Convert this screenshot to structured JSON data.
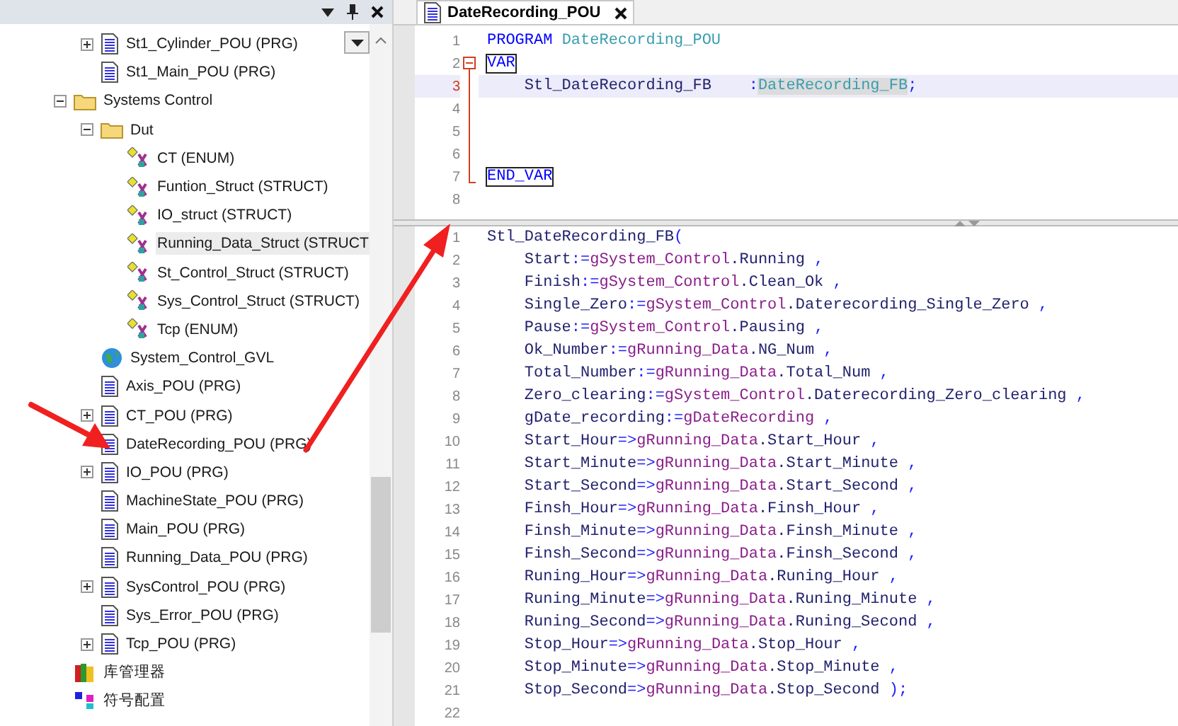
{
  "tree": [
    {
      "children": [
        {
          "label": "St1_Cylinder_POU (PRG)",
          "kind": "pou",
          "expanded": false,
          "selected": false
        },
        {
          "label": "St1_Main_POU (PRG)",
          "kind": "pou",
          "selected": false
        }
      ]
    },
    {
      "label": "Systems Control",
      "kind": "folder",
      "expanded": true,
      "selected": false,
      "children": [
        {
          "label": "Dut",
          "kind": "folder",
          "expanded": true,
          "selected": false,
          "children": [
            {
              "label": "CT (ENUM)",
              "kind": "dut",
              "selected": false
            },
            {
              "label": "Funtion_Struct (STRUCT)",
              "kind": "dut",
              "selected": false
            },
            {
              "label": "IO_struct (STRUCT)",
              "kind": "dut",
              "selected": false
            },
            {
              "label": "Running_Data_Struct (STRUCT",
              "kind": "dut",
              "selected": true
            },
            {
              "label": "St_Control_Struct (STRUCT)",
              "kind": "dut",
              "selected": false
            },
            {
              "label": "Sys_Control_Struct (STRUCT)",
              "kind": "dut",
              "selected": false
            },
            {
              "label": "Tcp (ENUM)",
              "kind": "dut",
              "selected": false
            }
          ]
        },
        {
          "label": "System_Control_GVL",
          "kind": "gvl",
          "selected": false
        },
        {
          "label": "Axis_POU (PRG)",
          "kind": "pou",
          "selected": false
        },
        {
          "label": "CT_POU (PRG)",
          "kind": "pou",
          "expanded": false,
          "selected": false
        },
        {
          "label": "DateRecording_POU (PRG)",
          "kind": "pou",
          "selected": false
        },
        {
          "label": "IO_POU (PRG)",
          "kind": "pou",
          "expanded": false,
          "selected": false
        },
        {
          "label": "MachineState_POU (PRG)",
          "kind": "pou",
          "selected": false
        },
        {
          "label": "Main_POU (PRG)",
          "kind": "pou",
          "selected": false
        },
        {
          "label": "Running_Data_POU (PRG)",
          "kind": "pou",
          "selected": false
        },
        {
          "label": "SysControl_POU (PRG)",
          "kind": "pou",
          "expanded": false,
          "selected": false
        },
        {
          "label": "Sys_Error_POU (PRG)",
          "kind": "pou",
          "selected": false
        },
        {
          "label": "Tcp_POU (PRG)",
          "kind": "pou",
          "expanded": false,
          "selected": false
        }
      ]
    },
    {
      "label": "库管理器",
      "kind": "library",
      "selected": false
    },
    {
      "label": "符号配置",
      "kind": "symbol",
      "selected": false
    }
  ],
  "editor": {
    "tab": {
      "label": "DateRecording_POU",
      "selected": true
    },
    "declaration": [
      {
        "number": "1",
        "current": false,
        "kind": "plain",
        "tokens": [
          {
            "text": "PROGRAM ",
            "kind": "keyword"
          },
          {
            "text": "DateRecording_POU",
            "kind": "type"
          }
        ]
      },
      {
        "number": "2",
        "current": false,
        "kind": "fold_start",
        "tokens": [
          {
            "text": "VAR",
            "kind": "keyword_boxed"
          }
        ]
      },
      {
        "number": "3",
        "current": true,
        "kind": "fold_inside",
        "tokens": [
          {
            "text": "    Stl_DateRecording_FB    ",
            "kind": "name"
          },
          {
            "text": ":",
            "kind": "operator"
          },
          {
            "text": "DateRecording_FB",
            "kind": "type_marked"
          },
          {
            "text": ";",
            "kind": "operator"
          }
        ]
      },
      {
        "number": "4",
        "current": false,
        "kind": "fold_inside"
      },
      {
        "number": "5",
        "current": false,
        "kind": "fold_inside"
      },
      {
        "number": "6",
        "current": false,
        "kind": "fold_inside"
      },
      {
        "number": "7",
        "current": false,
        "kind": "fold_end",
        "tokens": [
          {
            "text": "END_VAR",
            "kind": "keyword_boxed"
          }
        ]
      },
      {
        "number": "8",
        "current": false,
        "kind": "plain"
      }
    ],
    "body": [
      {
        "number": "1",
        "current": false,
        "tokens": [
          {
            "text": "Stl_DateRecording_FB",
            "kind": "name"
          },
          {
            "text": "(",
            "kind": "operator"
          }
        ]
      },
      {
        "number": "2",
        "current": false,
        "tokens": [
          {
            "text": "    Start",
            "kind": "name"
          },
          {
            "text": ":=",
            "kind": "operator"
          },
          {
            "text": "gSystem_Control",
            "kind": "global"
          },
          {
            "text": ".Running",
            "kind": "name"
          },
          {
            "text": " ,",
            "kind": "operator"
          }
        ]
      },
      {
        "number": "3",
        "current": false,
        "tokens": [
          {
            "text": "    Finish",
            "kind": "name"
          },
          {
            "text": ":=",
            "kind": "operator"
          },
          {
            "text": "gSystem_Control",
            "kind": "global"
          },
          {
            "text": ".Clean_Ok",
            "kind": "name"
          },
          {
            "text": " ,",
            "kind": "operator"
          }
        ]
      },
      {
        "number": "4",
        "current": false,
        "tokens": [
          {
            "text": "    Single_Zero",
            "kind": "name"
          },
          {
            "text": ":=",
            "kind": "operator"
          },
          {
            "text": "gSystem_Control",
            "kind": "global"
          },
          {
            "text": ".Daterecording_Single_Zero",
            "kind": "name"
          },
          {
            "text": " ,",
            "kind": "operator"
          }
        ]
      },
      {
        "number": "5",
        "current": false,
        "tokens": [
          {
            "text": "    Pause",
            "kind": "name"
          },
          {
            "text": ":=",
            "kind": "operator"
          },
          {
            "text": "gSystem_Control",
            "kind": "global"
          },
          {
            "text": ".Pausing",
            "kind": "name"
          },
          {
            "text": " ,",
            "kind": "operator"
          }
        ]
      },
      {
        "number": "6",
        "current": false,
        "tokens": [
          {
            "text": "    Ok_Number",
            "kind": "name"
          },
          {
            "text": ":=",
            "kind": "operator"
          },
          {
            "text": "gRunning_Data",
            "kind": "global"
          },
          {
            "text": ".NG_Num",
            "kind": "name"
          },
          {
            "text": " ,",
            "kind": "operator"
          }
        ]
      },
      {
        "number": "7",
        "current": false,
        "tokens": [
          {
            "text": "    Total_Number",
            "kind": "name"
          },
          {
            "text": ":=",
            "kind": "operator"
          },
          {
            "text": "gRunning_Data",
            "kind": "global"
          },
          {
            "text": ".Total_Num",
            "kind": "name"
          },
          {
            "text": " ,",
            "kind": "operator"
          }
        ]
      },
      {
        "number": "8",
        "current": false,
        "tokens": [
          {
            "text": "    Zero_clearing",
            "kind": "name"
          },
          {
            "text": ":=",
            "kind": "operator"
          },
          {
            "text": "gSystem_Control",
            "kind": "global"
          },
          {
            "text": ".Daterecording_Zero_clearing",
            "kind": "name"
          },
          {
            "text": " ,",
            "kind": "operator"
          }
        ]
      },
      {
        "number": "9",
        "current": false,
        "tokens": [
          {
            "text": "    gDate_recording",
            "kind": "name"
          },
          {
            "text": ":=",
            "kind": "operator"
          },
          {
            "text": "gDateRecording",
            "kind": "global"
          },
          {
            "text": " ,",
            "kind": "operator"
          }
        ]
      },
      {
        "number": "10",
        "current": false,
        "tokens": [
          {
            "text": "    Start_Hour",
            "kind": "name"
          },
          {
            "text": "=>",
            "kind": "operator"
          },
          {
            "text": "gRunning_Data",
            "kind": "global"
          },
          {
            "text": ".Start_Hour",
            "kind": "name"
          },
          {
            "text": " ,",
            "kind": "operator"
          }
        ]
      },
      {
        "number": "11",
        "current": false,
        "tokens": [
          {
            "text": "    Start_Minute",
            "kind": "name"
          },
          {
            "text": "=>",
            "kind": "operator"
          },
          {
            "text": "gRunning_Data",
            "kind": "global"
          },
          {
            "text": ".Start_Minute",
            "kind": "name"
          },
          {
            "text": " ,",
            "kind": "operator"
          }
        ]
      },
      {
        "number": "12",
        "current": false,
        "tokens": [
          {
            "text": "    Start_Second",
            "kind": "name"
          },
          {
            "text": "=>",
            "kind": "operator"
          },
          {
            "text": "gRunning_Data",
            "kind": "global"
          },
          {
            "text": ".Start_Second",
            "kind": "name"
          },
          {
            "text": " ,",
            "kind": "operator"
          }
        ]
      },
      {
        "number": "13",
        "current": false,
        "tokens": [
          {
            "text": "    Finsh_Hour",
            "kind": "name"
          },
          {
            "text": "=>",
            "kind": "operator"
          },
          {
            "text": "gRunning_Data",
            "kind": "global"
          },
          {
            "text": ".Finsh_Hour",
            "kind": "name"
          },
          {
            "text": " ,",
            "kind": "operator"
          }
        ]
      },
      {
        "number": "14",
        "current": false,
        "tokens": [
          {
            "text": "    Finsh_Minute",
            "kind": "name"
          },
          {
            "text": "=>",
            "kind": "operator"
          },
          {
            "text": "gRunning_Data",
            "kind": "global"
          },
          {
            "text": ".Finsh_Minute",
            "kind": "name"
          },
          {
            "text": " ,",
            "kind": "operator"
          }
        ]
      },
      {
        "number": "15",
        "current": false,
        "tokens": [
          {
            "text": "    Finsh_Second",
            "kind": "name"
          },
          {
            "text": "=>",
            "kind": "operator"
          },
          {
            "text": "gRunning_Data",
            "kind": "global"
          },
          {
            "text": ".Finsh_Second",
            "kind": "name"
          },
          {
            "text": " ,",
            "kind": "operator"
          }
        ]
      },
      {
        "number": "16",
        "current": false,
        "tokens": [
          {
            "text": "    Runing_Hour",
            "kind": "name"
          },
          {
            "text": "=>",
            "kind": "operator"
          },
          {
            "text": "gRunning_Data",
            "kind": "global"
          },
          {
            "text": ".Runing_Hour",
            "kind": "name"
          },
          {
            "text": " ,",
            "kind": "operator"
          }
        ]
      },
      {
        "number": "17",
        "current": false,
        "tokens": [
          {
            "text": "    Runing_Minute",
            "kind": "name"
          },
          {
            "text": "=>",
            "kind": "operator"
          },
          {
            "text": "gRunning_Data",
            "kind": "global"
          },
          {
            "text": ".Runing_Minute",
            "kind": "name"
          },
          {
            "text": " ,",
            "kind": "operator"
          }
        ]
      },
      {
        "number": "18",
        "current": false,
        "tokens": [
          {
            "text": "    Runing_Second",
            "kind": "name"
          },
          {
            "text": "=>",
            "kind": "operator"
          },
          {
            "text": "gRunning_Data",
            "kind": "global"
          },
          {
            "text": ".Runing_Second",
            "kind": "name"
          },
          {
            "text": " ,",
            "kind": "operator"
          }
        ]
      },
      {
        "number": "19",
        "current": false,
        "tokens": [
          {
            "text": "    Stop_Hour",
            "kind": "name"
          },
          {
            "text": "=>",
            "kind": "operator"
          },
          {
            "text": "gRunning_Data",
            "kind": "global"
          },
          {
            "text": ".Stop_Hour",
            "kind": "name"
          },
          {
            "text": " ,",
            "kind": "operator"
          }
        ]
      },
      {
        "number": "20",
        "current": false,
        "tokens": [
          {
            "text": "    Stop_Minute",
            "kind": "name"
          },
          {
            "text": "=>",
            "kind": "operator"
          },
          {
            "text": "gRunning_Data",
            "kind": "global"
          },
          {
            "text": ".Stop_Minute",
            "kind": "name"
          },
          {
            "text": " ,",
            "kind": "operator"
          }
        ]
      },
      {
        "number": "21",
        "current": false,
        "tokens": [
          {
            "text": "    Stop_Second",
            "kind": "name"
          },
          {
            "text": "=>",
            "kind": "operator"
          },
          {
            "text": "gRunning_Data",
            "kind": "global"
          },
          {
            "text": ".Stop_Second",
            "kind": "name"
          },
          {
            "text": " );",
            "kind": "operator"
          }
        ]
      },
      {
        "number": "22",
        "current": false
      }
    ]
  }
}
